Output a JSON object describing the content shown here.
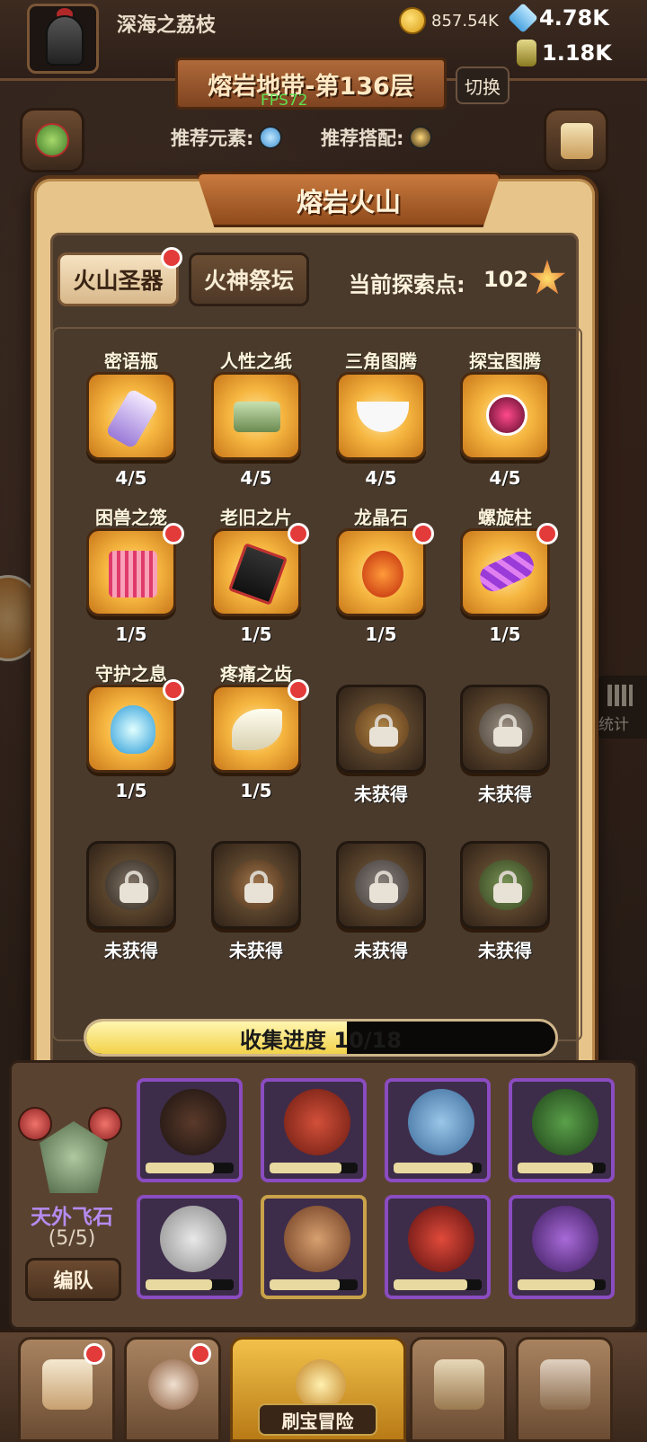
{
  "player": {
    "name": "深海之荔枝"
  },
  "resources": {
    "gold": "857.54K",
    "gems": "4.78K",
    "potions": "1.18K"
  },
  "level": {
    "title": "熔岩地带-第136层",
    "fps": "FPS72",
    "switch_label": "切换"
  },
  "recommend": {
    "element_label": "推荐元素:",
    "combo_label": "推荐搭配:"
  },
  "side": {
    "stats_label": "统计"
  },
  "modal": {
    "title": "熔岩火山",
    "tabs": [
      {
        "label": "火山圣器",
        "active": true,
        "has_notification": true
      },
      {
        "label": "火神祭坛",
        "active": false,
        "has_notification": false
      }
    ],
    "explore_label": "当前探索点:",
    "explore_value": "102",
    "items": [
      {
        "name": "密语瓶",
        "count": "4/5",
        "icon": "bottle-icon",
        "locked": false,
        "dot": false
      },
      {
        "name": "人性之纸",
        "count": "4/5",
        "icon": "paper-stack-icon",
        "locked": false,
        "dot": false
      },
      {
        "name": "三角图腾",
        "count": "4/5",
        "icon": "triangle-totem-icon",
        "locked": false,
        "dot": false
      },
      {
        "name": "探宝图腾",
        "count": "4/5",
        "icon": "treasure-totem-icon",
        "locked": false,
        "dot": false
      },
      {
        "name": "困兽之笼",
        "count": "1/5",
        "icon": "cage-icon",
        "locked": false,
        "dot": true
      },
      {
        "name": "老旧之片",
        "count": "1/5",
        "icon": "old-shard-icon",
        "locked": false,
        "dot": true
      },
      {
        "name": "龙晶石",
        "count": "1/5",
        "icon": "dragon-crystal-icon",
        "locked": false,
        "dot": true
      },
      {
        "name": "螺旋柱",
        "count": "1/5",
        "icon": "spiral-pillar-icon",
        "locked": false,
        "dot": true
      },
      {
        "name": "守护之息",
        "count": "1/5",
        "icon": "guardian-breath-icon",
        "locked": false,
        "dot": true
      },
      {
        "name": "疼痛之齿",
        "count": "1/5",
        "icon": "pain-tooth-icon",
        "locked": false,
        "dot": true
      },
      {
        "name": "",
        "count": "未获得",
        "icon": "locked-mask-icon",
        "locked": true,
        "dot": false
      },
      {
        "name": "",
        "count": "未获得",
        "icon": "locked-teapot-icon",
        "locked": true,
        "dot": false
      },
      {
        "name": "",
        "count": "未获得",
        "icon": "locked-disc-icon",
        "locked": true,
        "dot": false
      },
      {
        "name": "",
        "count": "未获得",
        "icon": "locked-orb-icon",
        "locked": true,
        "dot": false
      },
      {
        "name": "",
        "count": "未获得",
        "icon": "locked-stone-icon",
        "locked": true,
        "dot": false
      },
      {
        "name": "",
        "count": "未获得",
        "icon": "locked-leaf-icon",
        "locked": true,
        "dot": false
      }
    ],
    "progress": {
      "label": "收集进度 10/18",
      "current": 10,
      "total": 18,
      "fraction": 0.556
    }
  },
  "team": {
    "name": "天外飞石",
    "count": "(5/5)",
    "formation_label": "编队"
  },
  "bottom_nav": {
    "center_label": "刷宝冒险"
  },
  "colors": {
    "accent": "#f2d24a",
    "notify": "#e33a3a",
    "team_name": "#b48cf0"
  }
}
